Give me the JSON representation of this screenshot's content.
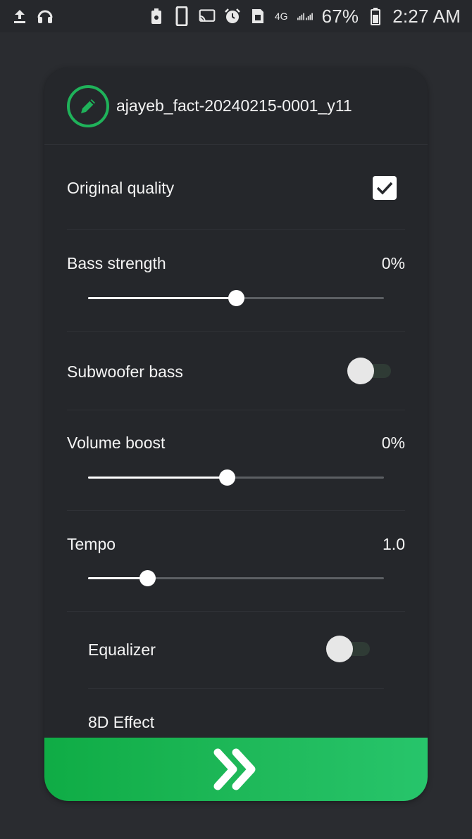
{
  "status_bar": {
    "left_icons": [
      "upload-icon",
      "headphones-icon"
    ],
    "right_icons": [
      "battery-saver-icon",
      "phone-icon",
      "cast-icon",
      "alarm-icon",
      "sim-icon"
    ],
    "network": "4G",
    "battery": "67%",
    "time": "2:27 AM"
  },
  "dialog": {
    "edit_icon": "pencil-icon",
    "file_name": "ajayeb_fact-20240215-0001_y11",
    "original_quality": {
      "label": "Original quality",
      "checked": true
    },
    "bass_strength": {
      "label": "Bass strength",
      "value": "0%",
      "position": 0.5
    },
    "subwoofer_bass": {
      "label": "Subwoofer bass",
      "enabled": false
    },
    "volume_boost": {
      "label": "Volume boost",
      "value": "0%",
      "position": 0.47
    },
    "tempo": {
      "label": "Tempo",
      "value": "1.0",
      "position": 0.2
    },
    "equalizer": {
      "label": "Equalizer",
      "enabled": false
    },
    "effect_8d": {
      "label": "8D Effect"
    },
    "confirm_icon": "double-chevron-right-icon"
  },
  "colors": {
    "accent": "#1fb25a",
    "background": "#2a2c30",
    "card": "#25272b"
  }
}
